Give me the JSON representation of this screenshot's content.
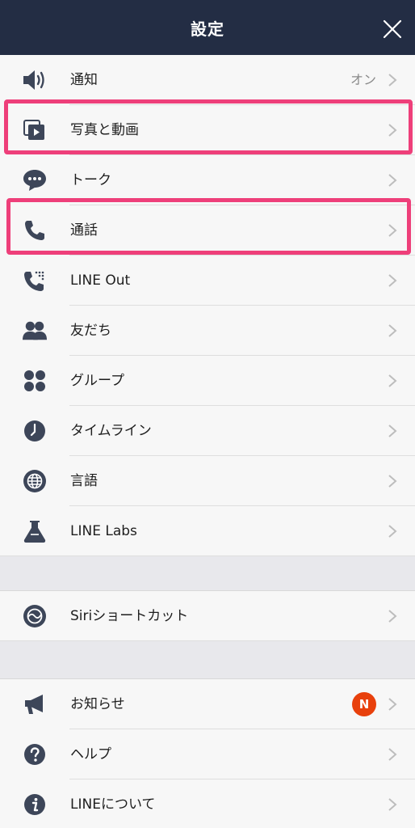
{
  "header": {
    "title": "設定"
  },
  "colors": {
    "header_bg": "#232d44",
    "icon": "#3d4659",
    "chevron": "#bdbdbd",
    "highlight": "#ee3f7a",
    "badge": "#e8400c"
  },
  "section1": [
    {
      "label": "通知",
      "icon": "speaker-icon",
      "value": "オン"
    },
    {
      "label": "写真と動画",
      "icon": "photo-video-icon"
    },
    {
      "label": "トーク",
      "icon": "chat-bubble-icon"
    },
    {
      "label": "通話",
      "icon": "phone-icon"
    },
    {
      "label": "LINE Out",
      "icon": "phone-out-icon"
    },
    {
      "label": "友だち",
      "icon": "friends-icon"
    },
    {
      "label": "グループ",
      "icon": "group-icon"
    },
    {
      "label": "タイムライン",
      "icon": "clock-icon"
    },
    {
      "label": "言語",
      "icon": "globe-icon"
    },
    {
      "label": "LINE Labs",
      "icon": "flask-icon"
    }
  ],
  "section2": [
    {
      "label": "Siriショートカット",
      "icon": "siri-icon"
    }
  ],
  "section3": [
    {
      "label": "お知らせ",
      "icon": "megaphone-icon",
      "badge": "N"
    },
    {
      "label": "ヘルプ",
      "icon": "help-icon"
    },
    {
      "label": "LINEについて",
      "icon": "info-icon"
    }
  ]
}
